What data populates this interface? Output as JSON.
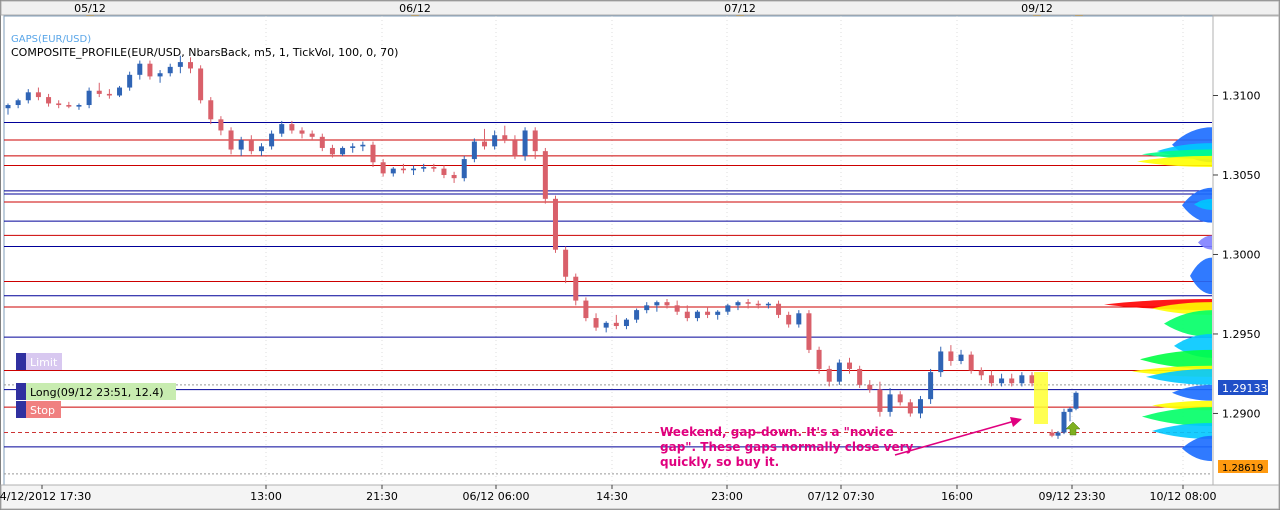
{
  "chart_data": {
    "type": "candlestick",
    "indicator_name": "GAPS(EUR/USD)",
    "indicator_params": "COMPOSITE_PROFILE(EUR/USD, NbarsBack, m5, 1, TickVol, 100, 0, 70)",
    "top_date_labels": [
      "05/12",
      "06/12",
      "07/12",
      "09/12"
    ],
    "x_axis_labels": [
      "04/12/2012 17:30",
      "13:00",
      "21:30",
      "06/12 06:00",
      "14:30",
      "23:00",
      "07/12 07:30",
      "16:00",
      "09/12 23:30",
      "10/12 08:00"
    ],
    "y_axis_labels": [
      "1.3100",
      "1.3050",
      "1.3000",
      "1.2950",
      "1.2900"
    ],
    "ylim": [
      1.2855,
      1.315
    ],
    "current_price": "1.29133",
    "low_marker_price": "1.28619",
    "levels": {
      "red": [
        1.3072,
        1.3062,
        1.3056,
        1.3033,
        1.3012,
        1.2983,
        1.2967,
        1.2927,
        1.2904
      ],
      "blue": [
        1.3083,
        1.304,
        1.3038,
        1.3021,
        1.3005,
        1.2974,
        1.2948,
        1.2915,
        1.2879
      ]
    },
    "order_tags": {
      "limit": "Limit",
      "long": "Long(09/12 23:51, 12.4)",
      "stop": "Stop"
    },
    "annotation": "Weekend, gap-down. It's a \"novice gap\". These gaps normally close very quickly, so buy it.",
    "colors": {
      "up": "#2f64b5",
      "down": "#d9606a",
      "red_level": "#cc0000",
      "blue_level": "#000099",
      "annotation": "#e0007f",
      "highlight": "#ffff33",
      "buy_arrow": "#7fb020",
      "price_tag": "#2050c8",
      "low_tag": "#ff9a10"
    },
    "candles": [
      [
        1.3092,
        1.3095,
        1.3088,
        1.3094
      ],
      [
        1.3094,
        1.3098,
        1.3092,
        1.3097
      ],
      [
        1.3097,
        1.3104,
        1.3095,
        1.3102
      ],
      [
        1.3102,
        1.3105,
        1.3097,
        1.3099
      ],
      [
        1.3099,
        1.3101,
        1.3093,
        1.3095
      ],
      [
        1.3095,
        1.3097,
        1.3092,
        1.3094
      ],
      [
        1.3094,
        1.3096,
        1.3092,
        1.3093
      ],
      [
        1.3093,
        1.3095,
        1.3091,
        1.3094
      ],
      [
        1.3094,
        1.3105,
        1.3092,
        1.3103
      ],
      [
        1.3103,
        1.3108,
        1.3099,
        1.3101
      ],
      [
        1.3101,
        1.3104,
        1.3098,
        1.31
      ],
      [
        1.31,
        1.3106,
        1.3099,
        1.3105
      ],
      [
        1.3105,
        1.3115,
        1.3103,
        1.3113
      ],
      [
        1.3113,
        1.3122,
        1.311,
        1.312
      ],
      [
        1.312,
        1.3122,
        1.311,
        1.3112
      ],
      [
        1.3112,
        1.3116,
        1.3108,
        1.3114
      ],
      [
        1.3114,
        1.312,
        1.3112,
        1.3118
      ],
      [
        1.3118,
        1.3125,
        1.3114,
        1.3121
      ],
      [
        1.3121,
        1.3124,
        1.3114,
        1.3117
      ],
      [
        1.3117,
        1.3119,
        1.3095,
        1.3097
      ],
      [
        1.3097,
        1.3099,
        1.3082,
        1.3085
      ],
      [
        1.3085,
        1.3087,
        1.3075,
        1.3078
      ],
      [
        1.3078,
        1.308,
        1.3063,
        1.3066
      ],
      [
        1.3066,
        1.3074,
        1.3062,
        1.3072
      ],
      [
        1.3072,
        1.3075,
        1.3063,
        1.3065
      ],
      [
        1.3065,
        1.307,
        1.3062,
        1.3068
      ],
      [
        1.3068,
        1.3078,
        1.3066,
        1.3076
      ],
      [
        1.3076,
        1.3084,
        1.3074,
        1.3082
      ],
      [
        1.3082,
        1.3084,
        1.3076,
        1.3078
      ],
      [
        1.3078,
        1.308,
        1.3073,
        1.3076
      ],
      [
        1.3076,
        1.3078,
        1.3072,
        1.3074
      ],
      [
        1.3074,
        1.3076,
        1.3065,
        1.3067
      ],
      [
        1.3067,
        1.3069,
        1.3061,
        1.3063
      ],
      [
        1.3063,
        1.3068,
        1.3062,
        1.3067
      ],
      [
        1.3067,
        1.307,
        1.3064,
        1.3068
      ],
      [
        1.3068,
        1.3071,
        1.3065,
        1.3069
      ],
      [
        1.3069,
        1.3071,
        1.3055,
        1.3058
      ],
      [
        1.3058,
        1.306,
        1.3049,
        1.3051
      ],
      [
        1.3051,
        1.3055,
        1.3049,
        1.3054
      ],
      [
        1.3054,
        1.3057,
        1.3051,
        1.3053
      ],
      [
        1.3053,
        1.3056,
        1.305,
        1.3054
      ],
      [
        1.3054,
        1.3057,
        1.3052,
        1.3055
      ],
      [
        1.3055,
        1.3057,
        1.3052,
        1.3054
      ],
      [
        1.3054,
        1.3056,
        1.3048,
        1.305
      ],
      [
        1.305,
        1.3052,
        1.3045,
        1.3048
      ],
      [
        1.3048,
        1.3062,
        1.3046,
        1.306
      ],
      [
        1.306,
        1.3073,
        1.3058,
        1.3071
      ],
      [
        1.3071,
        1.3079,
        1.3066,
        1.3068
      ],
      [
        1.3068,
        1.3078,
        1.3066,
        1.3075
      ],
      [
        1.3075,
        1.3081,
        1.307,
        1.3072
      ],
      [
        1.3072,
        1.3075,
        1.306,
        1.3062
      ],
      [
        1.3062,
        1.308,
        1.3059,
        1.3078
      ],
      [
        1.3078,
        1.308,
        1.306,
        1.3065
      ],
      [
        1.3065,
        1.3067,
        1.3032,
        1.3035
      ],
      [
        1.3035,
        1.3037,
        1.3001,
        1.3003
      ],
      [
        1.3003,
        1.3005,
        1.2982,
        1.2986
      ],
      [
        1.2986,
        1.2988,
        1.2968,
        1.2971
      ],
      [
        1.2971,
        1.2973,
        1.2958,
        1.296
      ],
      [
        1.296,
        1.2963,
        1.2952,
        1.2954
      ],
      [
        1.2954,
        1.2958,
        1.2951,
        1.2957
      ],
      [
        1.2957,
        1.2962,
        1.2953,
        1.2955
      ],
      [
        1.2955,
        1.296,
        1.2953,
        1.2959
      ],
      [
        1.2959,
        1.2966,
        1.2957,
        1.2965
      ],
      [
        1.2965,
        1.297,
        1.2963,
        1.2968
      ],
      [
        1.2968,
        1.2971,
        1.2964,
        1.297
      ],
      [
        1.297,
        1.2972,
        1.2966,
        1.2968
      ],
      [
        1.2968,
        1.2971,
        1.2962,
        1.2964
      ],
      [
        1.2964,
        1.2968,
        1.2958,
        1.296
      ],
      [
        1.296,
        1.2965,
        1.2958,
        1.2964
      ],
      [
        1.2964,
        1.2967,
        1.296,
        1.2962
      ],
      [
        1.2962,
        1.2965,
        1.2959,
        1.2964
      ],
      [
        1.2964,
        1.2969,
        1.2962,
        1.2968
      ],
      [
        1.2968,
        1.2971,
        1.2965,
        1.297
      ],
      [
        1.297,
        1.2972,
        1.2966,
        1.2969
      ],
      [
        1.2969,
        1.2971,
        1.2966,
        1.2968
      ],
      [
        1.2968,
        1.297,
        1.2966,
        1.2969
      ],
      [
        1.2969,
        1.2971,
        1.296,
        1.2962
      ],
      [
        1.2962,
        1.2964,
        1.2954,
        1.2956
      ],
      [
        1.2956,
        1.2965,
        1.2954,
        1.2963
      ],
      [
        1.2963,
        1.2965,
        1.2938,
        1.294
      ],
      [
        1.294,
        1.2942,
        1.2925,
        1.2928
      ],
      [
        1.2928,
        1.293,
        1.2917,
        1.292
      ],
      [
        1.292,
        1.2934,
        1.2918,
        1.2932
      ],
      [
        1.2932,
        1.2935,
        1.2925,
        1.2928
      ],
      [
        1.2928,
        1.293,
        1.2916,
        1.2918
      ],
      [
        1.2918,
        1.2921,
        1.2913,
        1.2915
      ],
      [
        1.2915,
        1.292,
        1.2898,
        1.2901
      ],
      [
        1.2901,
        1.2916,
        1.2898,
        1.2912
      ],
      [
        1.2912,
        1.2914,
        1.2905,
        1.2907
      ],
      [
        1.2907,
        1.2909,
        1.2898,
        1.29
      ],
      [
        1.29,
        1.2911,
        1.2897,
        1.2909
      ],
      [
        1.2909,
        1.2928,
        1.2906,
        1.2926
      ],
      [
        1.2926,
        1.2942,
        1.2923,
        1.2939
      ],
      [
        1.2939,
        1.2943,
        1.293,
        1.2933
      ],
      [
        1.2933,
        1.294,
        1.2931,
        1.2937
      ],
      [
        1.2937,
        1.2939,
        1.2925,
        1.2927
      ],
      [
        1.2927,
        1.2929,
        1.2921,
        1.2924
      ],
      [
        1.2924,
        1.2927,
        1.2917,
        1.2919
      ],
      [
        1.2919,
        1.2925,
        1.2917,
        1.2922
      ],
      [
        1.2922,
        1.2925,
        1.2917,
        1.2919
      ],
      [
        1.2919,
        1.2926,
        1.2917,
        1.2924
      ],
      [
        1.2924,
        1.2926,
        1.2917,
        1.2919
      ],
      [
        1.2888,
        1.289,
        1.2885,
        1.2886
      ],
      [
        1.2886,
        1.2889,
        1.2884,
        1.2888
      ],
      [
        1.2888,
        1.2903,
        1.2887,
        1.2901
      ],
      [
        1.2901,
        1.2904,
        1.2895,
        1.2903
      ],
      [
        1.2903,
        1.2914,
        1.2902,
        1.2913
      ]
    ]
  }
}
